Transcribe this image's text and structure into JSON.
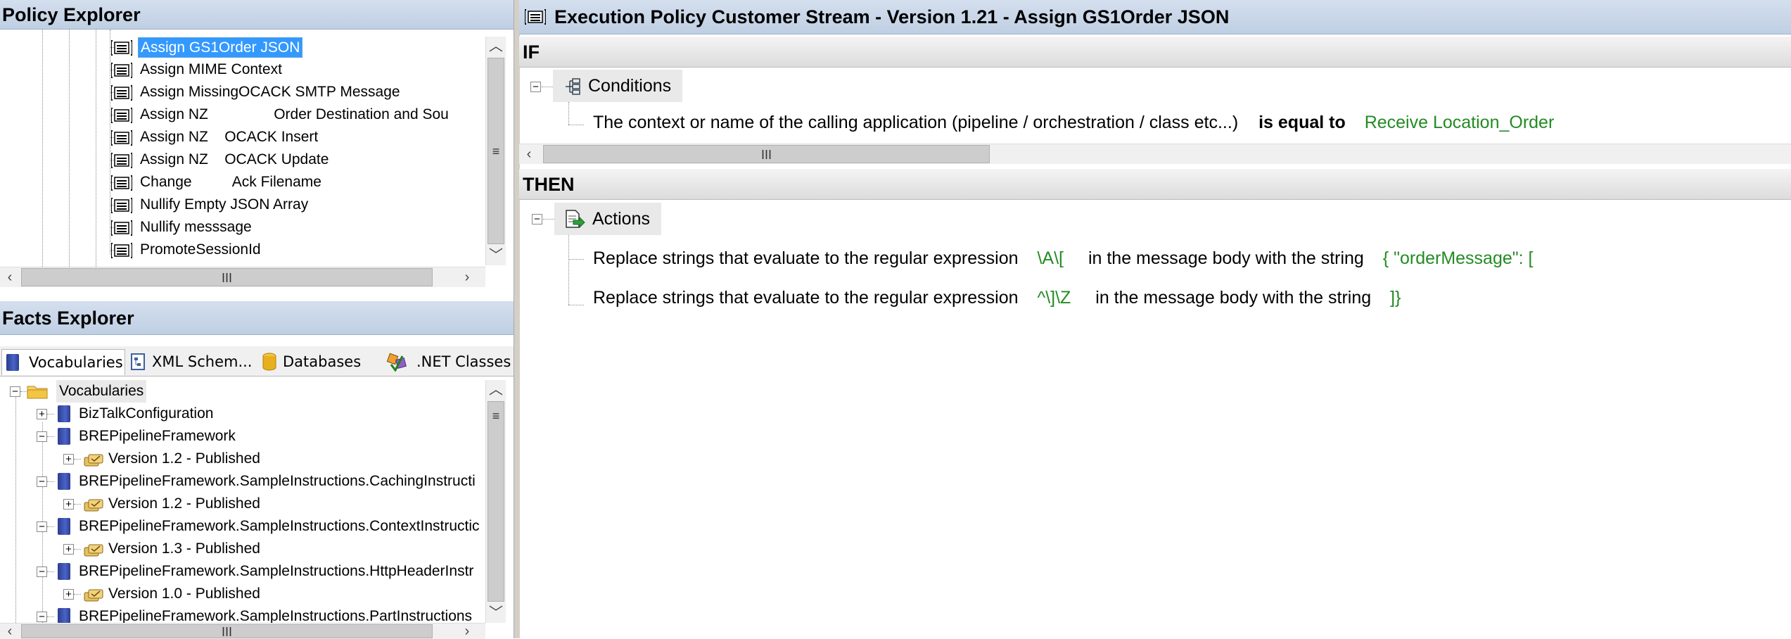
{
  "policy_explorer": {
    "title": "Policy Explorer",
    "rules": [
      {
        "label": "Assign GS1Order JSON",
        "selected": true
      },
      {
        "label": "Assign MIME Context"
      },
      {
        "label": "Assign MissingOCACK SMTP Message"
      },
      {
        "label": "Assign NZ                Order Destination and Sou"
      },
      {
        "label": "Assign NZ    OCACK Insert"
      },
      {
        "label": "Assign NZ    OCACK Update"
      },
      {
        "label": "Change          Ack Filename"
      },
      {
        "label": "Nullify Empty JSON Array"
      },
      {
        "label": "Nullify messsage"
      },
      {
        "label": "PromoteSessionId"
      }
    ]
  },
  "facts_explorer": {
    "title": "Facts Explorer",
    "tabs": [
      {
        "label": "Vocabularies",
        "active": true,
        "icon": "book-icon"
      },
      {
        "label": "XML Schem...",
        "icon": "xml-schema-icon"
      },
      {
        "label": "Databases",
        "icon": "database-icon"
      },
      {
        "label": ".NET Classes",
        "icon": "net-classes-icon"
      }
    ],
    "tree": [
      {
        "label": "Vocabularies",
        "level": 0,
        "kind": "folder",
        "expander": "−"
      },
      {
        "label": "BizTalkConfiguration",
        "level": 1,
        "kind": "book",
        "expander": "+"
      },
      {
        "label": "BREPipelineFramework",
        "level": 1,
        "kind": "book",
        "expander": "−"
      },
      {
        "label": "Version 1.2 - Published",
        "level": 2,
        "kind": "version",
        "expander": "+"
      },
      {
        "label": "BREPipelineFramework.SampleInstructions.CachingInstructi",
        "level": 1,
        "kind": "book",
        "expander": "−"
      },
      {
        "label": "Version 1.2 - Published",
        "level": 2,
        "kind": "version",
        "expander": "+"
      },
      {
        "label": "BREPipelineFramework.SampleInstructions.ContextInstructic",
        "level": 1,
        "kind": "book",
        "expander": "−"
      },
      {
        "label": "Version 1.3 - Published",
        "level": 2,
        "kind": "version",
        "expander": "+"
      },
      {
        "label": "BREPipelineFramework.SampleInstructions.HttpHeaderInstr",
        "level": 1,
        "kind": "book",
        "expander": "−"
      },
      {
        "label": "Version 1.0 - Published",
        "level": 2,
        "kind": "version",
        "expander": "+"
      },
      {
        "label": "BREPipelineFramework.SampleInstructions.PartInstructions",
        "level": 1,
        "kind": "book",
        "expander": "−"
      }
    ]
  },
  "rule_editor": {
    "title": "Execution Policy Customer Stream - Version 1.21 - Assign GS1Order JSON",
    "if_label": "IF",
    "conditions_label": "Conditions",
    "condition": {
      "subject": "The context or name of the calling application (pipeline / orchestration / class etc...)",
      "operator": "is equal to",
      "value": "Receive Location_Order"
    },
    "then_label": "THEN",
    "actions_label": "Actions",
    "actions": [
      {
        "prefix": "Replace strings that evaluate to the regular expression",
        "pattern": "\\A\\[",
        "middle": "in the message body with the string",
        "replacement": "{ \"orderMessage\": ["
      },
      {
        "prefix": "Replace strings that evaluate to the regular expression",
        "pattern": "^\\]\\Z",
        "middle": "in the message body with the string",
        "replacement": "]}"
      }
    ]
  },
  "scrollbar": {
    "thumb_glyph": "III",
    "up": "^",
    "down": "v",
    "left": "<",
    "right": ">"
  }
}
